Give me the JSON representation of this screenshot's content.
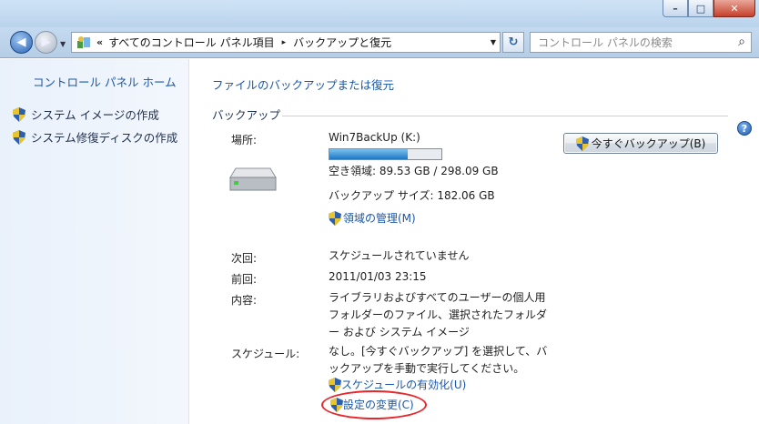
{
  "window": {
    "minimize": "–",
    "maximize": "□",
    "close": "✕"
  },
  "address_bar": {
    "overflow": "«",
    "crumbs": [
      "すべてのコントロール パネル項目",
      "バックアップと復元"
    ],
    "separator": "▸"
  },
  "search": {
    "placeholder": "コントロール パネルの検索"
  },
  "left_pane": {
    "home": "コントロール パネル ホーム",
    "tasks": [
      "システム イメージの作成",
      "システム修復ディスクの作成"
    ]
  },
  "main": {
    "head_link": "ファイルのバックアップまたは復元",
    "section_title": "バックアップ",
    "location_label": "場所:",
    "location_value": "Win7BackUp (K:)",
    "usage_fraction": 0.7,
    "free_space": "空き領域: 89.53 GB / 298.09 GB",
    "backup_size": "バックアップ サイズ: 182.06 GB",
    "manage_space": "領域の管理(M)",
    "backup_now": "今すぐバックアップ(B)",
    "next_label": "次回:",
    "next_value": "スケジュールされていません",
    "last_label": "前回:",
    "last_value": "2011/01/03 23:15",
    "contents_label": "内容:",
    "contents_lines": [
      "ライブラリおよびすべてのユーザーの個人用",
      "フォルダーのファイル、選択されたフォルダ",
      "ー および システム イメージ"
    ],
    "schedule_label": "スケジュール:",
    "schedule_lines": [
      "なし。[今すぐバックアップ] を選択して、バ",
      "ックアップを手動で実行してください。"
    ],
    "enable_schedule": "スケジュールの有効化(U)",
    "change_settings": "設定の変更(C)"
  },
  "colors": {
    "link": "#1a56a8",
    "highlight": "#e8262c",
    "progress": "#1b77c4"
  },
  "icons": [
    "back-arrow-icon",
    "forward-arrow-icon",
    "control-panel-icon",
    "refresh-icon",
    "search-icon",
    "uac-shield-icon",
    "drive-icon",
    "help-icon"
  ]
}
